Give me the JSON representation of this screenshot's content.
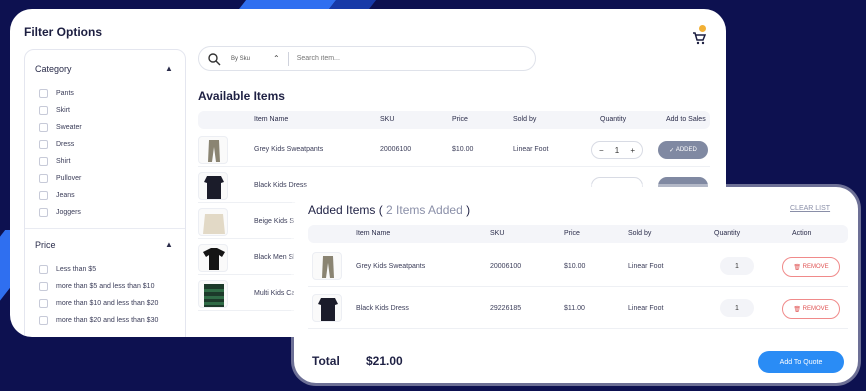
{
  "filter": {
    "title": "Filter Options",
    "category_label": "Category",
    "categories": [
      "Pants",
      "Skirt",
      "Sweater",
      "Dress",
      "Shirt",
      "Pullover",
      "Jeans",
      "Joggers"
    ],
    "price_label": "Price",
    "prices": [
      "Less than $5",
      "more than $5 and less than $10",
      "more than $10 and less than $20",
      "more than $20 and less than $30"
    ]
  },
  "search": {
    "sku_label": "By Sku",
    "placeholder": "Search item..."
  },
  "available": {
    "title": "Available Items",
    "headers": {
      "name": "Item Name",
      "sku": "SKU",
      "price": "Price",
      "sold_by": "Sold by",
      "quantity": "Quantity",
      "add": "Add to Sales"
    },
    "rows": [
      {
        "name": "Grey Kids Sweatpants",
        "sku": "20006100",
        "price": "$10.00",
        "sold_by": "Linear Foot",
        "qty": "1",
        "add_label": "ADDED"
      },
      {
        "name": "Black Kids Dress"
      },
      {
        "name": "Beige Kids Swe"
      },
      {
        "name": "Black Men Shirt"
      },
      {
        "name": "Multi Kids Card"
      }
    ],
    "minus": "−",
    "plus": "+"
  },
  "added": {
    "title": "Added Items (",
    "count": " 2 Items Added ",
    "close_paren": ")",
    "clear": "CLEAR LIST",
    "headers": {
      "name": "Item Name",
      "sku": "SKU",
      "price": "Price",
      "sold_by": "Sold by",
      "quantity": "Quantity",
      "action": "Action"
    },
    "rows": [
      {
        "name": "Grey Kids Sweatpants",
        "sku": "20006100",
        "price": "$10.00",
        "sold_by": "Linear Foot",
        "qty": "1",
        "remove": "REMOVE"
      },
      {
        "name": "Black Kids Dress",
        "sku": "29226185",
        "price": "$11.00",
        "sold_by": "Linear Foot",
        "qty": "1",
        "remove": "REMOVE"
      }
    ],
    "total_label": "Total",
    "total_value": "$21.00",
    "quote_button": "Add To Quote"
  },
  "colors": {
    "background": "#0d1150",
    "accent": "#2a8cf5",
    "added_button": "#8089a2",
    "remove": "#e05555"
  }
}
